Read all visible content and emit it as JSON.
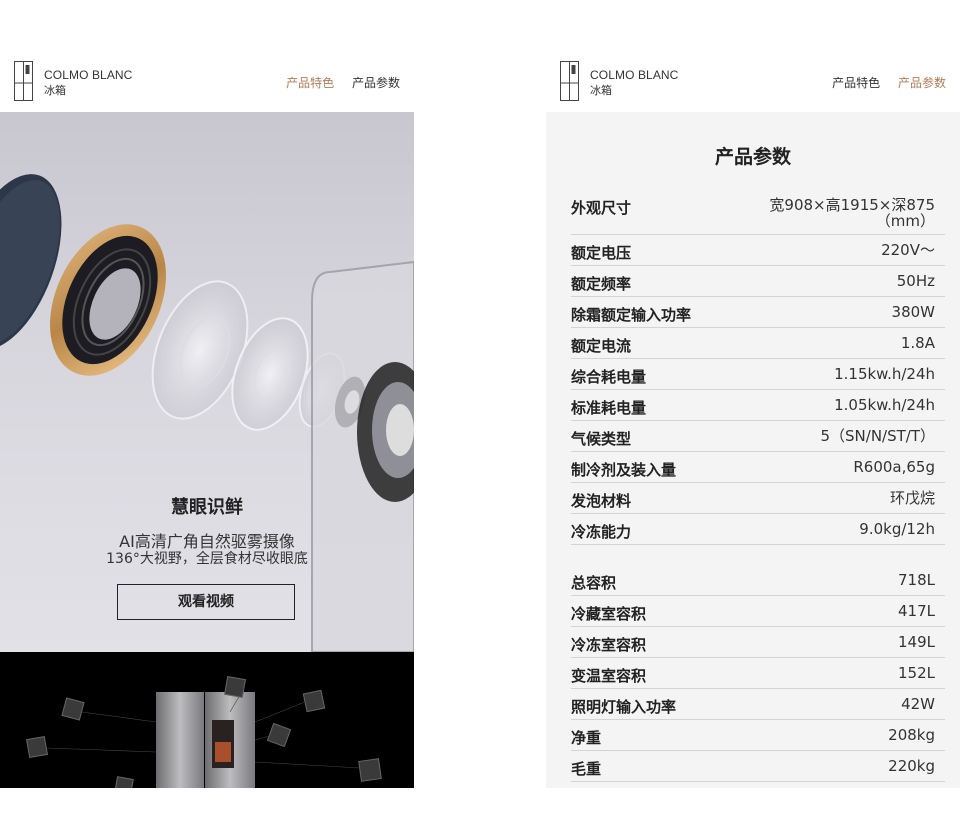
{
  "left": {
    "brand_name": "COLMO BLANC",
    "brand_sub": "冰箱",
    "nav": [
      "产品特色",
      "产品参数"
    ],
    "active_nav": 0,
    "hero": {
      "title": "慧眼识鲜",
      "subtitle_1": "AI高清广角自然驱雾摄像",
      "subtitle_2": "136°大视野，全层食材尽收眼底",
      "button_label": "观看视频"
    }
  },
  "right": {
    "brand_name": "COLMO BLANC",
    "brand_sub": "冰箱",
    "nav": [
      "产品特色",
      "产品参数"
    ],
    "active_nav": 1,
    "spec_title": "产品参数",
    "group1": [
      {
        "k": "外观尺寸",
        "v1": "宽908×高1915×深875",
        "v2": "（mm）"
      },
      {
        "k": "额定电压",
        "v1": "220V～"
      },
      {
        "k": "额定频率",
        "v1": "50Hz"
      },
      {
        "k": "除霜额定输入功率",
        "v1": "380W"
      },
      {
        "k": "额定电流",
        "v1": "1.8A"
      },
      {
        "k": "综合耗电量",
        "v1": "1.15kw.h/24h"
      },
      {
        "k": "标准耗电量",
        "v1": "1.05kw.h/24h"
      },
      {
        "k": "气候类型",
        "v1": "5（SN/N/ST/T）"
      },
      {
        "k": "制冷剂及装入量",
        "v1": "R600a,65g"
      },
      {
        "k": "发泡材料",
        "v1": "环戊烷"
      },
      {
        "k": "冷冻能力",
        "v1": "9.0kg/12h"
      }
    ],
    "group2": [
      {
        "k": "总容积",
        "v1": "718L"
      },
      {
        "k": "冷藏室容积",
        "v1": "417L"
      },
      {
        "k": "冷冻室容积",
        "v1": "149L"
      },
      {
        "k": "变温室容积",
        "v1": "152L"
      },
      {
        "k": "照明灯输入功率",
        "v1": "42W"
      },
      {
        "k": "净重",
        "v1": "208kg"
      },
      {
        "k": "毛重",
        "v1": "220kg"
      }
    ]
  }
}
